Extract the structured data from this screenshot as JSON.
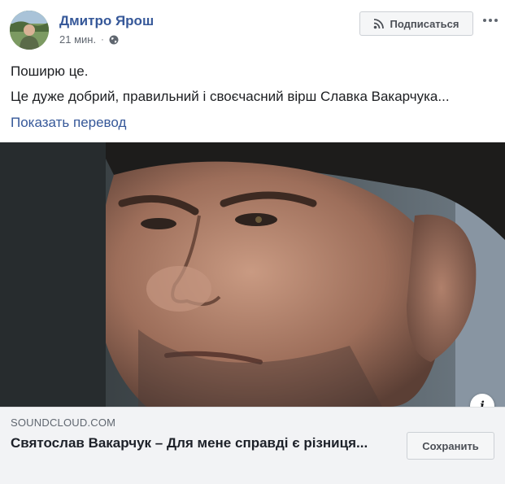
{
  "post": {
    "author_name": "Дмитро Ярош",
    "timestamp": "21 мин.",
    "separator": "·",
    "privacy_icon": "globe-icon",
    "subscribe_icon": "rss-icon",
    "subscribe_label": "Подписаться",
    "more_icon": "more-options-icon",
    "text_line_1": "Поширю це.",
    "text_line_2": "Це дуже добрий, правильний і своєчасний вірш Славка Вакарчука...",
    "translate_label": "Показать перевод"
  },
  "link_preview": {
    "info_icon": "i",
    "domain": "SOUNDCLOUD.COM",
    "title": "Святослав Вакарчук – Для мене справді є різниця...",
    "save_label": "Сохранить"
  },
  "colors": {
    "author_link": "#365899",
    "secondary_text": "#606770",
    "caption_bg": "#f2f3f5",
    "button_bg": "#f5f6f7"
  }
}
